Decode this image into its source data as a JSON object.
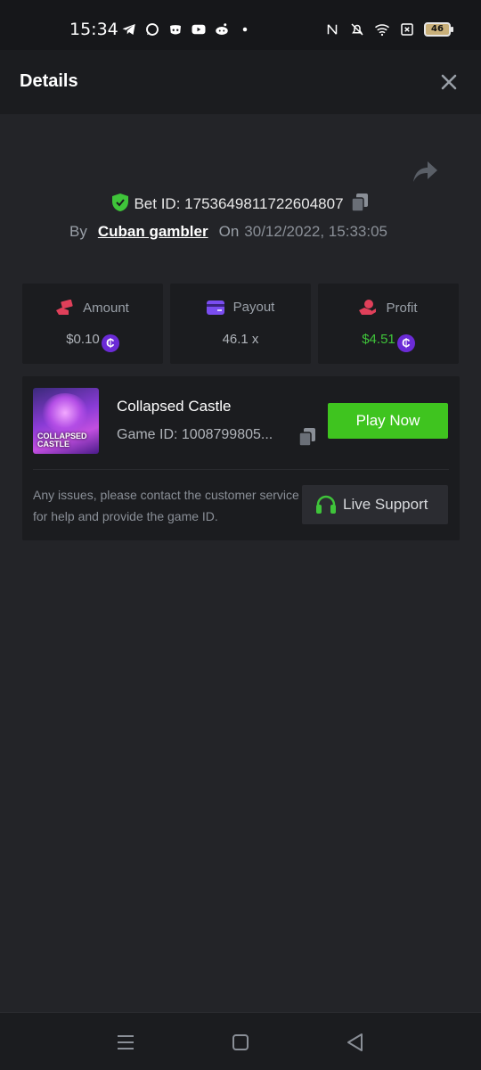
{
  "status_bar": {
    "time": "15:34",
    "battery": "46",
    "left_icons": [
      "telegram-icon",
      "whatsapp-icon",
      "discord-icon",
      "youtube-icon",
      "reddit-icon",
      "dot-icon"
    ],
    "right_icons": [
      "nfc-icon",
      "bell-off-icon",
      "wifi-icon",
      "sim-x-icon",
      "battery-icon"
    ]
  },
  "header": {
    "title": "Details"
  },
  "bet": {
    "id_text": "Bet ID: 1753649811722604807",
    "by_label": "By",
    "user": "Cuban gambler",
    "on_label": "On",
    "date": "30/12/2022, 15:33:05"
  },
  "stats": {
    "amount": {
      "label": "Amount",
      "value": "$0.10",
      "icon": "hand-money-icon"
    },
    "payout": {
      "label": "Payout",
      "value": "46.1 x",
      "icon": "card-icon"
    },
    "profit": {
      "label": "Profit",
      "value": "$4.51",
      "icon": "hand-coin-icon"
    }
  },
  "coin_symbol": "₵",
  "game": {
    "name": "Collapsed Castle",
    "id_text": "Game ID: 1008799805...",
    "thumb_line1": "COLLAPSED",
    "thumb_line2": "CASTLE",
    "play_label": "Play Now"
  },
  "support": {
    "help_text": "Any issues, please contact the customer service for help and provide the game ID.",
    "button_label": "Live Support"
  },
  "colors": {
    "background": "#232428",
    "card": "#1b1c1f",
    "green": "#3fc41f",
    "coin": "#6b2bd6",
    "profit_text": "#3fc43a"
  }
}
